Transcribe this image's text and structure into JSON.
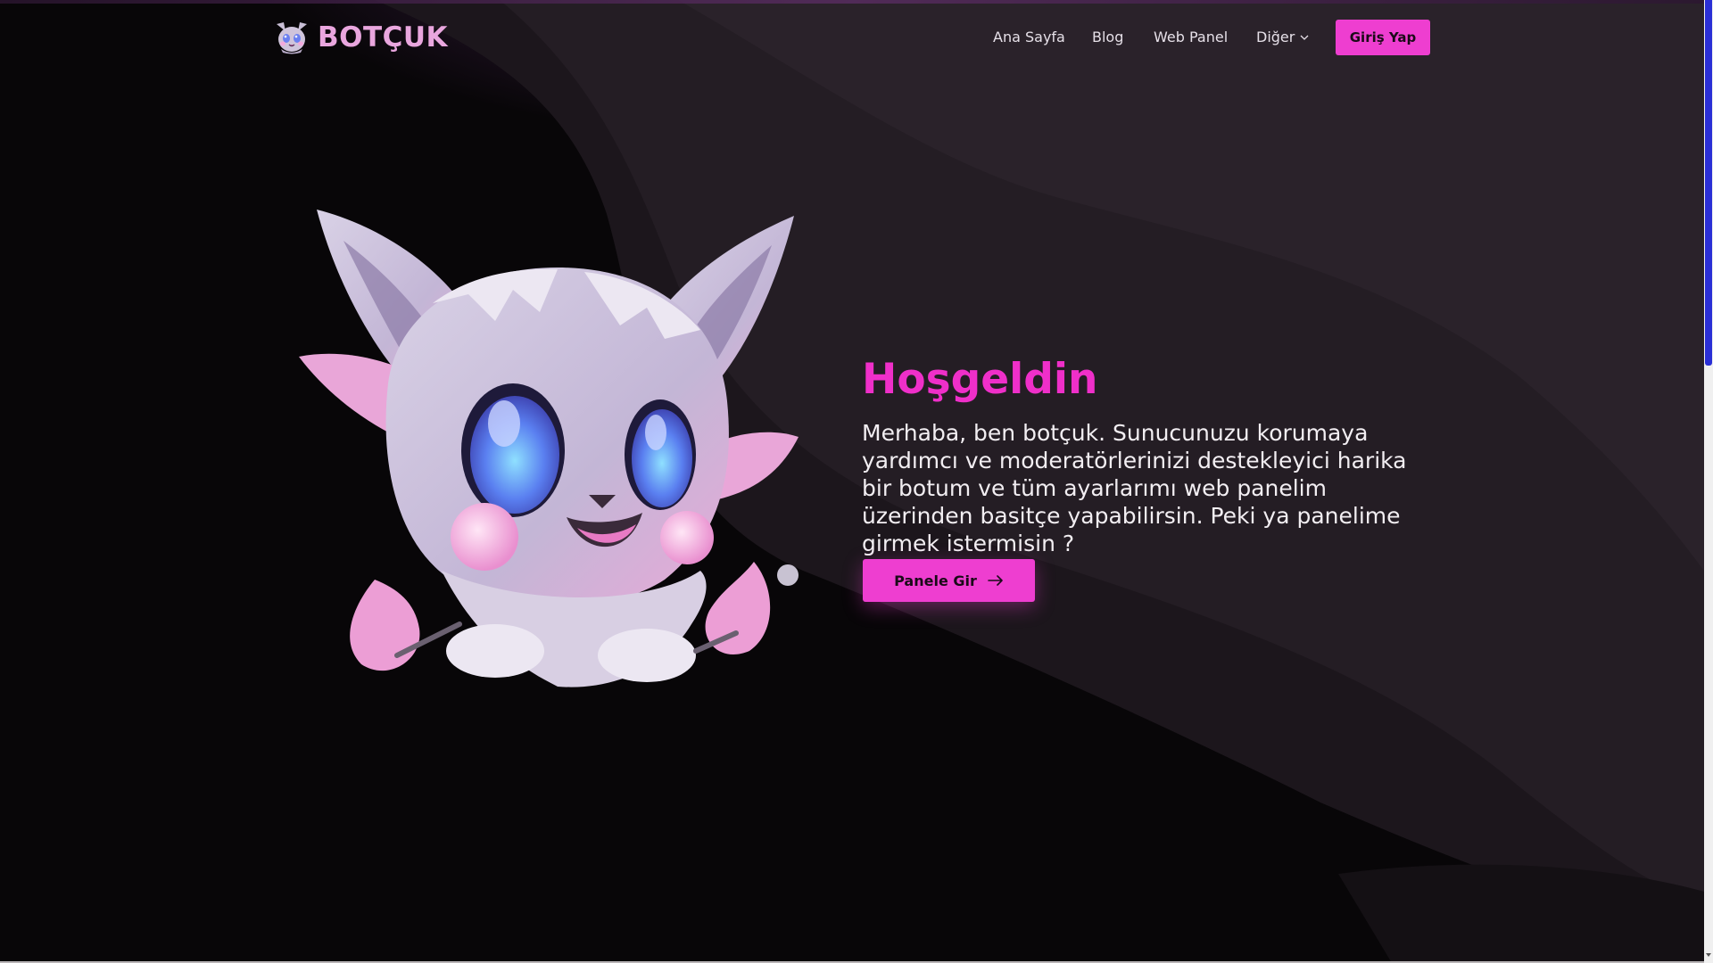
{
  "brand": {
    "name": "BOTÇUK",
    "logo_icon": "cat-mascot-logo-icon"
  },
  "nav": {
    "items": [
      {
        "label": "Ana Sayfa"
      },
      {
        "label": "Blog"
      },
      {
        "label": "Web Panel"
      },
      {
        "label": "Diğer",
        "icon": "chevron-down-icon"
      }
    ],
    "login_label": "Giriş Yap"
  },
  "hero": {
    "title": "Hoşgeldin",
    "text": "Merhaba, ben botçuk. Sunucunuzu korumaya yardımcı ve moderatörlerinizi destekleyici harika bir botum ve tüm ayarlarımı web panelim üzerinden basitçe yapabilirsin. Peki ya panelime girmek istermisin ?",
    "cta_label": "Panele Gir",
    "cta_icon": "arrow-right-icon",
    "mascot": "cat-mascot-illustration"
  },
  "colors": {
    "accent": "#ee3ed0",
    "title": "#ef2fc9",
    "background": "#080608",
    "scroll_thumb": "#2a2fd6"
  }
}
